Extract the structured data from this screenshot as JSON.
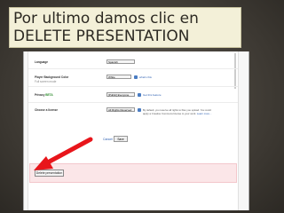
{
  "slide": {
    "title_line1": "Por ultimo damos clic en",
    "title_line2": "DELETE  PRESENTATION"
  },
  "form": {
    "language": {
      "label": "Language",
      "value": "Spanish"
    },
    "player_bg": {
      "label": "Player Background Color",
      "sublabel": "Full screen mode",
      "value": "White",
      "link": "what's this"
    },
    "privacy": {
      "label": "Privacy",
      "badge": "BETA",
      "value": "[Public] Everyone",
      "link": "Get this feature"
    },
    "license": {
      "label": "Choose a license",
      "value": "All Rights Reserved",
      "note1": "By default, you reserve all rights to files you upload. You could",
      "note2": "apply a Creative Commons license to your work.",
      "note_link": "Learn more..."
    },
    "cancel_label": "Cancel",
    "save_label": "Save"
  },
  "delete": {
    "button_label": "Delete presentation"
  },
  "colors": {
    "title_bg": "#f3f0d8",
    "arrow": "#e8151b",
    "delete_panel": "#fbe6e8"
  }
}
